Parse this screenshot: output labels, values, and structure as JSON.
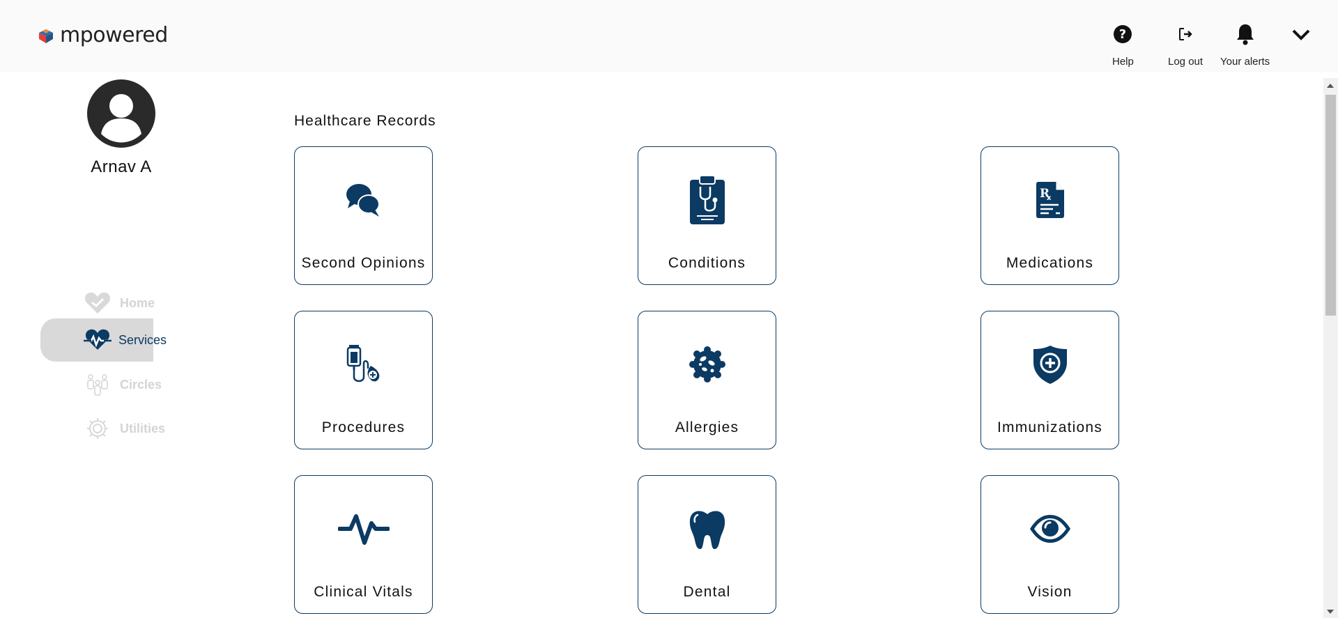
{
  "brand": {
    "name": "mpowered"
  },
  "header": {
    "help_label": "Help",
    "logout_label": "Log out",
    "alerts_label": "Your alerts"
  },
  "profile": {
    "name": "Arnav A"
  },
  "nav": {
    "items": [
      {
        "label": "Home",
        "icon": "heart-check-icon",
        "active": false
      },
      {
        "label": "Services",
        "icon": "heart-pulse-icon",
        "active": true
      },
      {
        "label": "Circles",
        "icon": "people-icon",
        "active": false
      },
      {
        "label": "Utilities",
        "icon": "gear-icon",
        "active": false
      }
    ]
  },
  "main": {
    "section_title": "Healthcare Records",
    "cards": [
      {
        "label": "Second Opinions",
        "icon": "chat-bubbles-icon"
      },
      {
        "label": "Conditions",
        "icon": "clipboard-stethoscope-icon"
      },
      {
        "label": "Medications",
        "icon": "prescription-icon"
      },
      {
        "label": "Procedures",
        "icon": "iv-drip-icon"
      },
      {
        "label": "Allergies",
        "icon": "allergen-icon"
      },
      {
        "label": "Immunizations",
        "icon": "shield-plus-icon"
      },
      {
        "label": "Clinical Vitals",
        "icon": "heartbeat-icon"
      },
      {
        "label": "Dental",
        "icon": "tooth-icon"
      },
      {
        "label": "Vision",
        "icon": "eye-icon"
      }
    ]
  },
  "colors": {
    "accent": "#0b3a63",
    "nav_inactive": "#d4d4d4",
    "active_bg": "#d9d9d9"
  }
}
